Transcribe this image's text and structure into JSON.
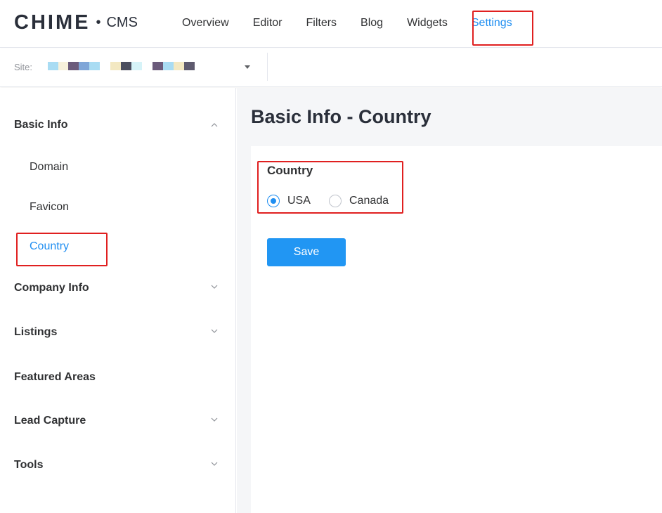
{
  "brand": {
    "logo_text": "CHIME",
    "separator": "•",
    "product": "CMS"
  },
  "nav": {
    "items": [
      {
        "label": "Overview"
      },
      {
        "label": "Editor"
      },
      {
        "label": "Filters"
      },
      {
        "label": "Blog"
      },
      {
        "label": "Widgets"
      },
      {
        "label": "Settings",
        "active": true
      }
    ]
  },
  "site": {
    "label": "Site:",
    "selected_value_redacted": true,
    "icon": "caret-down-icon"
  },
  "sidebar": {
    "sections": [
      {
        "label": "Basic Info",
        "expanded": true,
        "icon": "chevron-up-icon",
        "items": [
          {
            "label": "Domain"
          },
          {
            "label": "Favicon"
          },
          {
            "label": "Country",
            "active": true
          }
        ]
      },
      {
        "label": "Company Info",
        "expanded": false,
        "icon": "chevron-down-icon"
      },
      {
        "label": "Listings",
        "expanded": false,
        "icon": "chevron-down-icon"
      },
      {
        "label": "Featured Areas"
      },
      {
        "label": "Lead Capture",
        "expanded": false,
        "icon": "chevron-down-icon"
      },
      {
        "label": "Tools",
        "expanded": false,
        "icon": "chevron-down-icon"
      }
    ]
  },
  "main": {
    "title": "Basic Info - Country",
    "form": {
      "field_label": "Country",
      "options": [
        {
          "label": "USA",
          "checked": true
        },
        {
          "label": "Canada",
          "checked": false
        }
      ],
      "save_label": "Save"
    }
  },
  "colors": {
    "accent": "#1f8ef1",
    "button": "#2196f3",
    "highlight_box": "#e02020",
    "main_bg": "#f5f6f8"
  }
}
